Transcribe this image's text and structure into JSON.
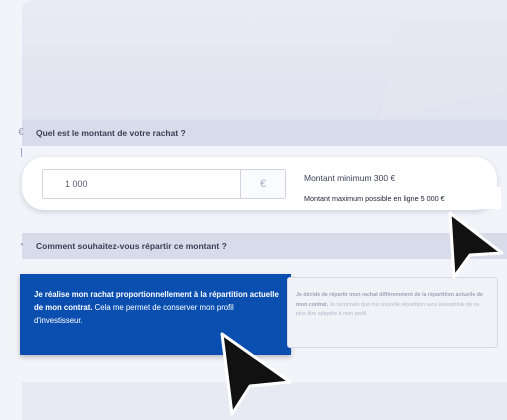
{
  "rachat": {
    "question": "Quel est le montant de votre rachat ?",
    "amount_value": "1 000",
    "currency_symbol": "€",
    "min_label": "Montant minimum 300 €",
    "max_label": "Montant maximum possible en ligne 5 000 €"
  },
  "repartition": {
    "question": "Comment souhaitez-vous répartir ce montant ?",
    "option_proportional": {
      "bold": "Je réalise mon rachat proportionnellement à la répartition actuelle de mon contrat.",
      "text": " Cela me permet de conserver mon profil d'investisseur."
    },
    "option_custom": {
      "bold": "Je décide de répartir mon rachat différemment de la répartition actuelle de mon contrat.",
      "text": " Je reconnais que ma nouvelle répartition sera susceptible de ne plus être adaptée à mon profil."
    }
  },
  "icons": {
    "step1": "euro-step-icon",
    "step2": "split-step-icon",
    "pointer": "cursor-arrow-icon"
  },
  "colors": {
    "selected_option": "#0a4fb0",
    "section_bar": "#d8dbe9",
    "background": "#f3f4f9"
  }
}
